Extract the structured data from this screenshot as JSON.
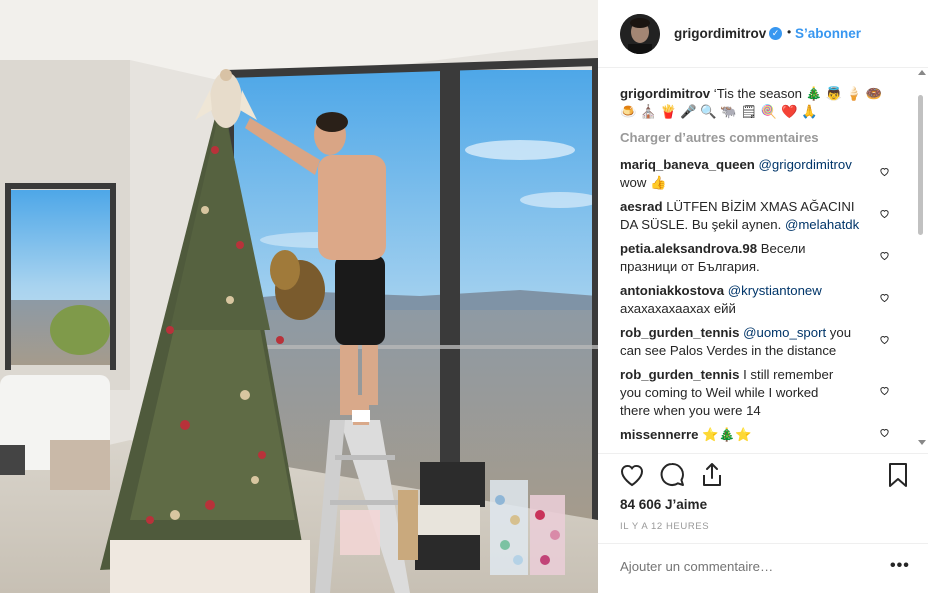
{
  "post": {
    "username": "grigordimitrov",
    "follow_label": "S’abonner",
    "dot": "•",
    "caption_user": "grigordimitrov",
    "caption_text": "‘Tis the season 🎄 👼 🍦 🍩",
    "caption_line2": "🍮 ⛪ 🍟 🎤 🔍 🐃 🗒 🍭 ❤️ 🙏",
    "load_more": "Charger d’autres commentaires",
    "likes": "84 606 J’aime",
    "time": "IL Y A 12 HEURES",
    "comment_placeholder": "Ajouter un commentaire…",
    "more": "•••"
  },
  "comments": [
    {
      "user": "mariq_baneva_queen",
      "text_line1_mention": "@grigordimitrov",
      "text_line2": "wow 👍"
    },
    {
      "user": "aesrad",
      "text_line1": "LÜTFEN BİZİM XMAS AĞACINI",
      "text_line2": "DA SÜSLE. Bu şekil aynen. ",
      "mention": "@melahatdk"
    },
    {
      "user": "petia.aleksandrova.98",
      "text_line1": "Весели",
      "text_line2": "празници от България."
    },
    {
      "user": "antoniakkostova",
      "text_line1_mention": "@krystiantonew",
      "text_line2": "ахахахахаахах ейй"
    },
    {
      "user": "rob_gurden_tennis",
      "text_line1_mention": "@uomo_sport",
      "text_line1_after": " you",
      "text_line2": "can see Palos Verdes in the distance"
    },
    {
      "user": "rob_gurden_tennis",
      "text_line1": "I still remember",
      "text_line2": "you coming to Weil while I worked",
      "text_line3": "there when you were 14"
    },
    {
      "user": "missennerre",
      "text_line1": "⭐🎄⭐"
    }
  ],
  "icons": [
    "heart-icon",
    "comment-icon",
    "share-icon",
    "bookmark-icon",
    "verified-icon"
  ],
  "colors": {
    "accent": "#3897f0",
    "mention": "#003569",
    "muted": "#999999"
  }
}
